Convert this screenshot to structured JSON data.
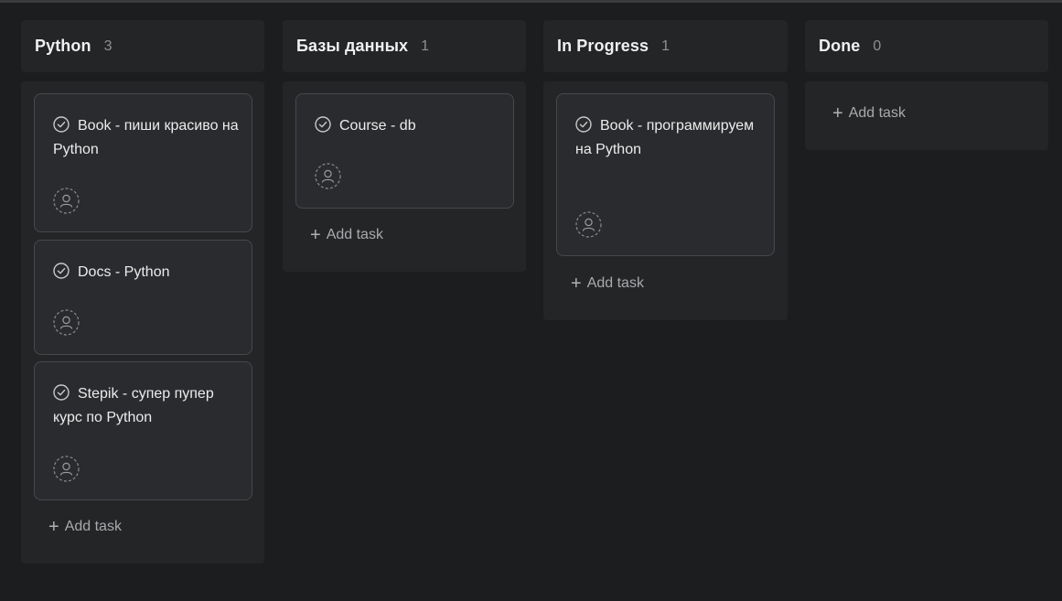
{
  "columns": [
    {
      "title": "Python",
      "count": "3",
      "add_label": "Add task",
      "cards": [
        {
          "title": "Book - пиши красиво на Python"
        },
        {
          "title": "Docs - Python"
        },
        {
          "title": "Stepik - супер пупер курс по Python"
        }
      ]
    },
    {
      "title": "Базы данных",
      "count": "1",
      "add_label": "Add task",
      "cards": [
        {
          "title": "Course - db"
        }
      ]
    },
    {
      "title": "In Progress",
      "count": "1",
      "add_label": "Add task",
      "cards": [
        {
          "title": "Book - программируем на Python"
        }
      ]
    },
    {
      "title": "Done",
      "count": "0",
      "add_label": "Add task",
      "cards": []
    }
  ],
  "icons": {
    "card_status": "check-circle-icon",
    "assignee": "user-placeholder-icon",
    "add": "plus-icon"
  }
}
